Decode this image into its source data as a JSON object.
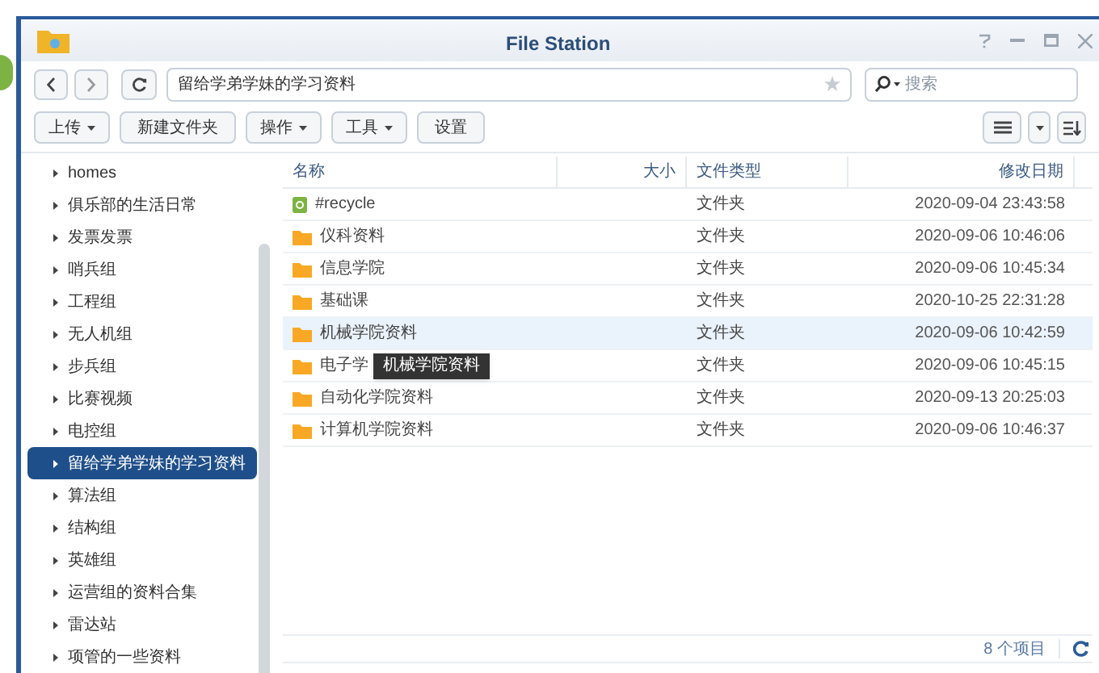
{
  "window": {
    "title": "File Station"
  },
  "nav": {
    "path": "留给学弟学妹的学习资料",
    "search_placeholder": "搜索"
  },
  "toolbar": [
    {
      "label": "上传",
      "dropdown": true
    },
    {
      "label": "新建文件夹",
      "dropdown": false
    },
    {
      "label": "操作",
      "dropdown": true
    },
    {
      "label": "工具",
      "dropdown": true
    },
    {
      "label": "设置",
      "dropdown": false
    }
  ],
  "sidebar": {
    "items": [
      {
        "label": "homes",
        "selected": false
      },
      {
        "label": "俱乐部的生活日常",
        "selected": false
      },
      {
        "label": "发票发票",
        "selected": false
      },
      {
        "label": "哨兵组",
        "selected": false
      },
      {
        "label": "工程组",
        "selected": false
      },
      {
        "label": "无人机组",
        "selected": false
      },
      {
        "label": "步兵组",
        "selected": false
      },
      {
        "label": "比赛视频",
        "selected": false
      },
      {
        "label": "电控组",
        "selected": false
      },
      {
        "label": "留给学弟学妹的学习资料",
        "selected": true
      },
      {
        "label": "算法组",
        "selected": false
      },
      {
        "label": "结构组",
        "selected": false
      },
      {
        "label": "英雄组",
        "selected": false
      },
      {
        "label": "运营组的资料合集",
        "selected": false
      },
      {
        "label": "雷达站",
        "selected": false
      },
      {
        "label": "项管的一些资料",
        "selected": false
      }
    ]
  },
  "table": {
    "columns": [
      "名称",
      "大小",
      "文件类型",
      "修改日期"
    ],
    "rows": [
      {
        "kind": "recycle",
        "name": "#recycle",
        "type": "文件夹",
        "modified": "2020-09-04 23:43:58",
        "hovered": false
      },
      {
        "kind": "folder",
        "name": "仪科资料",
        "type": "文件夹",
        "modified": "2020-09-06 10:46:06",
        "hovered": false
      },
      {
        "kind": "folder",
        "name": "信息学院",
        "type": "文件夹",
        "modified": "2020-09-06 10:45:34",
        "hovered": false
      },
      {
        "kind": "folder",
        "name": "基础课",
        "type": "文件夹",
        "modified": "2020-10-25 22:31:28",
        "hovered": false
      },
      {
        "kind": "folder",
        "name": "机械学院资料",
        "type": "文件夹",
        "modified": "2020-09-06 10:42:59",
        "hovered": true
      },
      {
        "kind": "folder",
        "name": "电子学",
        "type": "文件夹",
        "modified": "2020-09-06 10:45:15",
        "hovered": false
      },
      {
        "kind": "folder",
        "name": "自动化学院资料",
        "type": "文件夹",
        "modified": "2020-09-13 20:25:03",
        "hovered": false
      },
      {
        "kind": "folder",
        "name": "计算机学院资料",
        "type": "文件夹",
        "modified": "2020-09-06 10:46:37",
        "hovered": false
      }
    ]
  },
  "tooltip": "机械学院资料",
  "status_bar": {
    "count": "8 个项目"
  }
}
